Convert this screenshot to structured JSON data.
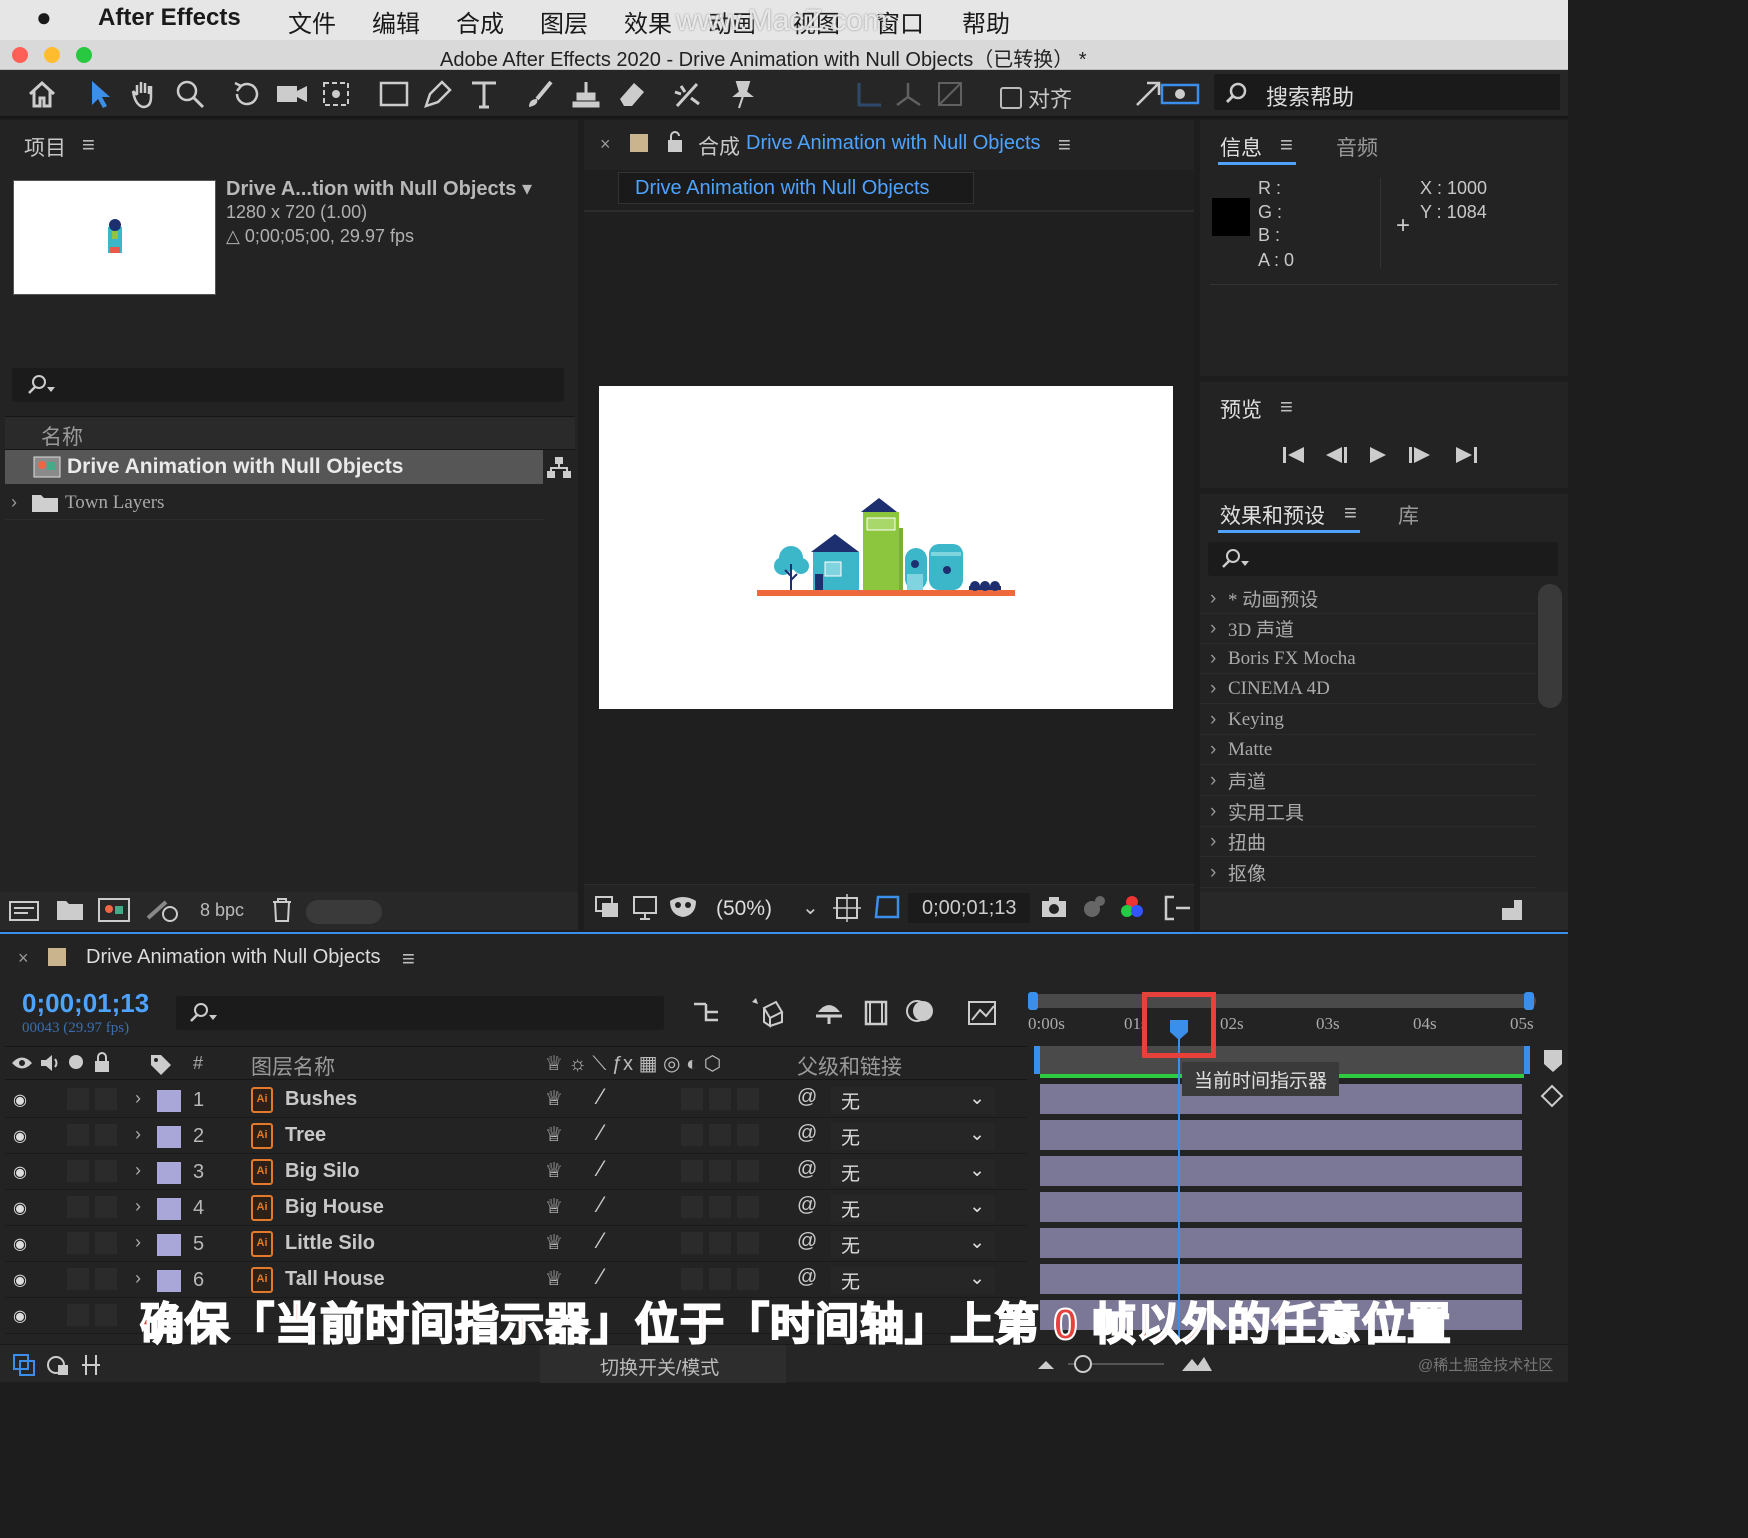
{
  "menubar": {
    "app_name": "After Effects",
    "items": [
      "文件",
      "编辑",
      "合成",
      "图层",
      "效果",
      "动画",
      "视图",
      "窗口",
      "帮助"
    ],
    "watermark": "www.MacZ.com"
  },
  "window": {
    "title": "Adobe After Effects 2020 - Drive Animation with Null Objects（已转换） *"
  },
  "toolbar": {
    "align_label": "对齐",
    "search_help_placeholder": "搜索帮助"
  },
  "project": {
    "title": "项目",
    "comp_name": "Drive A...tion with Null Objects",
    "comp_size": "1280 x 720 (1.00)",
    "comp_duration": "△ 0;00;05;00, 29.97 fps",
    "name_header": "名称",
    "items": [
      {
        "name": "Drive Animation with Null Objects",
        "type": "comp"
      },
      {
        "name": "Town Layers",
        "type": "folder"
      }
    ],
    "bpc": "8 bpc"
  },
  "composition": {
    "tab_prefix": "合成",
    "tab_name": "Drive Animation with Null Objects",
    "flowchart_label": "Drive Animation with Null Objects",
    "zoom": "(50%)",
    "timecode": "0;00;01;13"
  },
  "info": {
    "tab_info": "信息",
    "tab_audio": "音频",
    "r_label": "R :",
    "g_label": "G :",
    "b_label": "B :",
    "a_label": "A :  0",
    "x_label": "X :  1000",
    "y_label": "Y :  1084"
  },
  "preview": {
    "title": "预览"
  },
  "effects": {
    "tab_effects": "效果和预设",
    "tab_library": "库",
    "items": [
      "* 动画预设",
      "3D 声道",
      "Boris FX Mocha",
      "CINEMA 4D",
      "Keying",
      "Matte",
      "声道",
      "实用工具",
      "扭曲",
      "抠像"
    ]
  },
  "timeline": {
    "tab_name": "Drive Animation with Null Objects",
    "timecode": "0;00;01;13",
    "frames": "00043 (29.97 fps)",
    "col_hash": "#",
    "col_layer_name": "图层名称",
    "col_parent": "父级和链接",
    "ruler": [
      "0:00s",
      "01s",
      "02s",
      "03s",
      "04s",
      "05s"
    ],
    "tooltip": "当前时间指示器",
    "toggle_label": "切换开关/模式",
    "layers": [
      {
        "num": "1",
        "name": "Bushes",
        "parent": "无"
      },
      {
        "num": "2",
        "name": "Tree",
        "parent": "无"
      },
      {
        "num": "3",
        "name": "Big Silo",
        "parent": "无"
      },
      {
        "num": "4",
        "name": "Big House",
        "parent": "无"
      },
      {
        "num": "5",
        "name": "Little Silo",
        "parent": "无"
      },
      {
        "num": "6",
        "name": "Tall House",
        "parent": "无"
      }
    ]
  },
  "caption": "确保「当前时间指示器」位于「时间轴」上第 0 帧以外的任意位置",
  "corner_watermark": "@稀土掘金技术社区",
  "colors": {
    "accent_blue": "#3b8eea",
    "highlight_red": "#e8413b",
    "layer_label": "#a9a6d8",
    "ai_orange": "#e5792a"
  }
}
